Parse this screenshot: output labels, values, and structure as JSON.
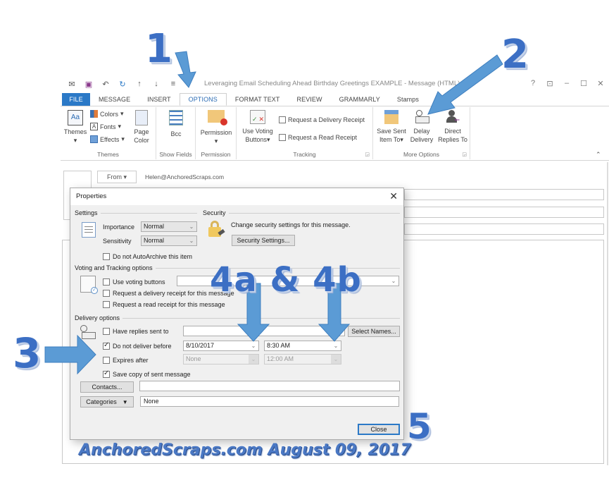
{
  "window": {
    "title": "Leveraging Email Scheduling Ahead Birthday Greetings EXAMPLE - Message (HTML)",
    "quick_access": [
      "mail-icon",
      "save-icon",
      "undo-icon",
      "redo-icon",
      "up-icon",
      "down-icon",
      "customize-icon"
    ],
    "controls": {
      "help": "?",
      "ribbon_display": "⊡",
      "minimize": "–",
      "maximize": "☐",
      "close": "✕"
    }
  },
  "tabs": [
    {
      "label": "FILE"
    },
    {
      "label": "MESSAGE"
    },
    {
      "label": "INSERT"
    },
    {
      "label": "OPTIONS",
      "active": true
    },
    {
      "label": "FORMAT TEXT"
    },
    {
      "label": "REVIEW"
    },
    {
      "label": "GRAMMARLY"
    },
    {
      "label": "Stamps"
    }
  ],
  "ribbon": {
    "themes": {
      "themes_label": "Themes",
      "colors_label": "Colors",
      "fonts_label": "Fonts",
      "effects_label": "Effects",
      "page_color_label": "Page Color",
      "group_label": "Themes"
    },
    "show_fields": {
      "bcc_label": "Bcc",
      "group_label": "Show Fields"
    },
    "permission": {
      "permission_label": "Permission",
      "group_label": "Permission"
    },
    "tracking": {
      "voting_label": "Use Voting Buttons",
      "delivery_receipt_label": "Request a Delivery Receipt",
      "read_receipt_label": "Request a Read Receipt",
      "group_label": "Tracking"
    },
    "more_options": {
      "save_sent_label": "Save Sent Item To",
      "delay_delivery_label": "Delay Delivery",
      "direct_replies_label": "Direct Replies To",
      "group_label": "More Options"
    }
  },
  "message": {
    "from_label": "From",
    "from_value": "Helen@AnchoredScraps.com"
  },
  "dialog": {
    "title": "Properties",
    "settings": {
      "section_label": "Settings",
      "importance_label": "Importance",
      "importance_value": "Normal",
      "sensitivity_label": "Sensitivity",
      "sensitivity_value": "Normal",
      "autoarchive_label": "Do not AutoArchive this item",
      "autoarchive_checked": false
    },
    "security": {
      "section_label": "Security",
      "description": "Change security settings for this message.",
      "button_label": "Security Settings..."
    },
    "voting": {
      "section_label": "Voting and Tracking options",
      "use_voting_label": "Use voting buttons",
      "use_voting_checked": false,
      "voting_value": "",
      "delivery_receipt_label": "Request a delivery receipt for this message",
      "delivery_receipt_checked": false,
      "read_receipt_label": "Request a read receipt for this message",
      "read_receipt_checked": false
    },
    "delivery": {
      "section_label": "Delivery options",
      "replies_label": "Have replies sent to",
      "replies_checked": false,
      "replies_value": "",
      "select_names_label": "Select Names...",
      "deliver_before_label": "Do not deliver before",
      "deliver_before_checked": true,
      "deliver_date": "8/10/2017",
      "deliver_time": "8:30 AM",
      "expires_label": "Expires after",
      "expires_checked": false,
      "expires_date": "None",
      "expires_time": "12:00 AM",
      "save_copy_label": "Save copy of sent message",
      "save_copy_checked": true
    },
    "contacts_label": "Contacts...",
    "contacts_value": "",
    "categories_label": "Categories",
    "categories_value": "None",
    "close_label": "Close"
  },
  "annotations": {
    "step1": "1",
    "step2": "2",
    "step3": "3",
    "step4": "4a & 4b",
    "step5": "5",
    "arrow_color": "#5b9bd5",
    "text_color": "#3c6fc4"
  },
  "footer": "AnchoredScraps.com August 09, 2017"
}
